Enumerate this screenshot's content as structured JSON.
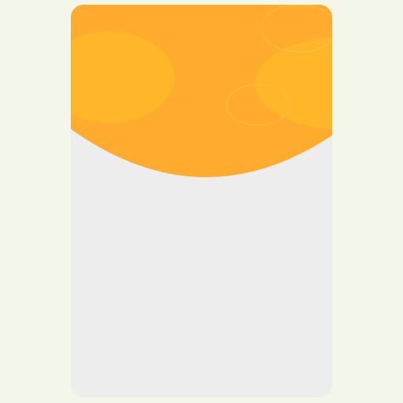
{
  "colors": {
    "page_background": "#F3F7EA",
    "card_background": "#EDEDED",
    "header_orange": "#FFAB2E",
    "blob_yellow": "#FFB628",
    "ring_stroke": "#FFC451"
  },
  "card": {
    "header_decoration": "orange-wave-header-with-circles"
  }
}
